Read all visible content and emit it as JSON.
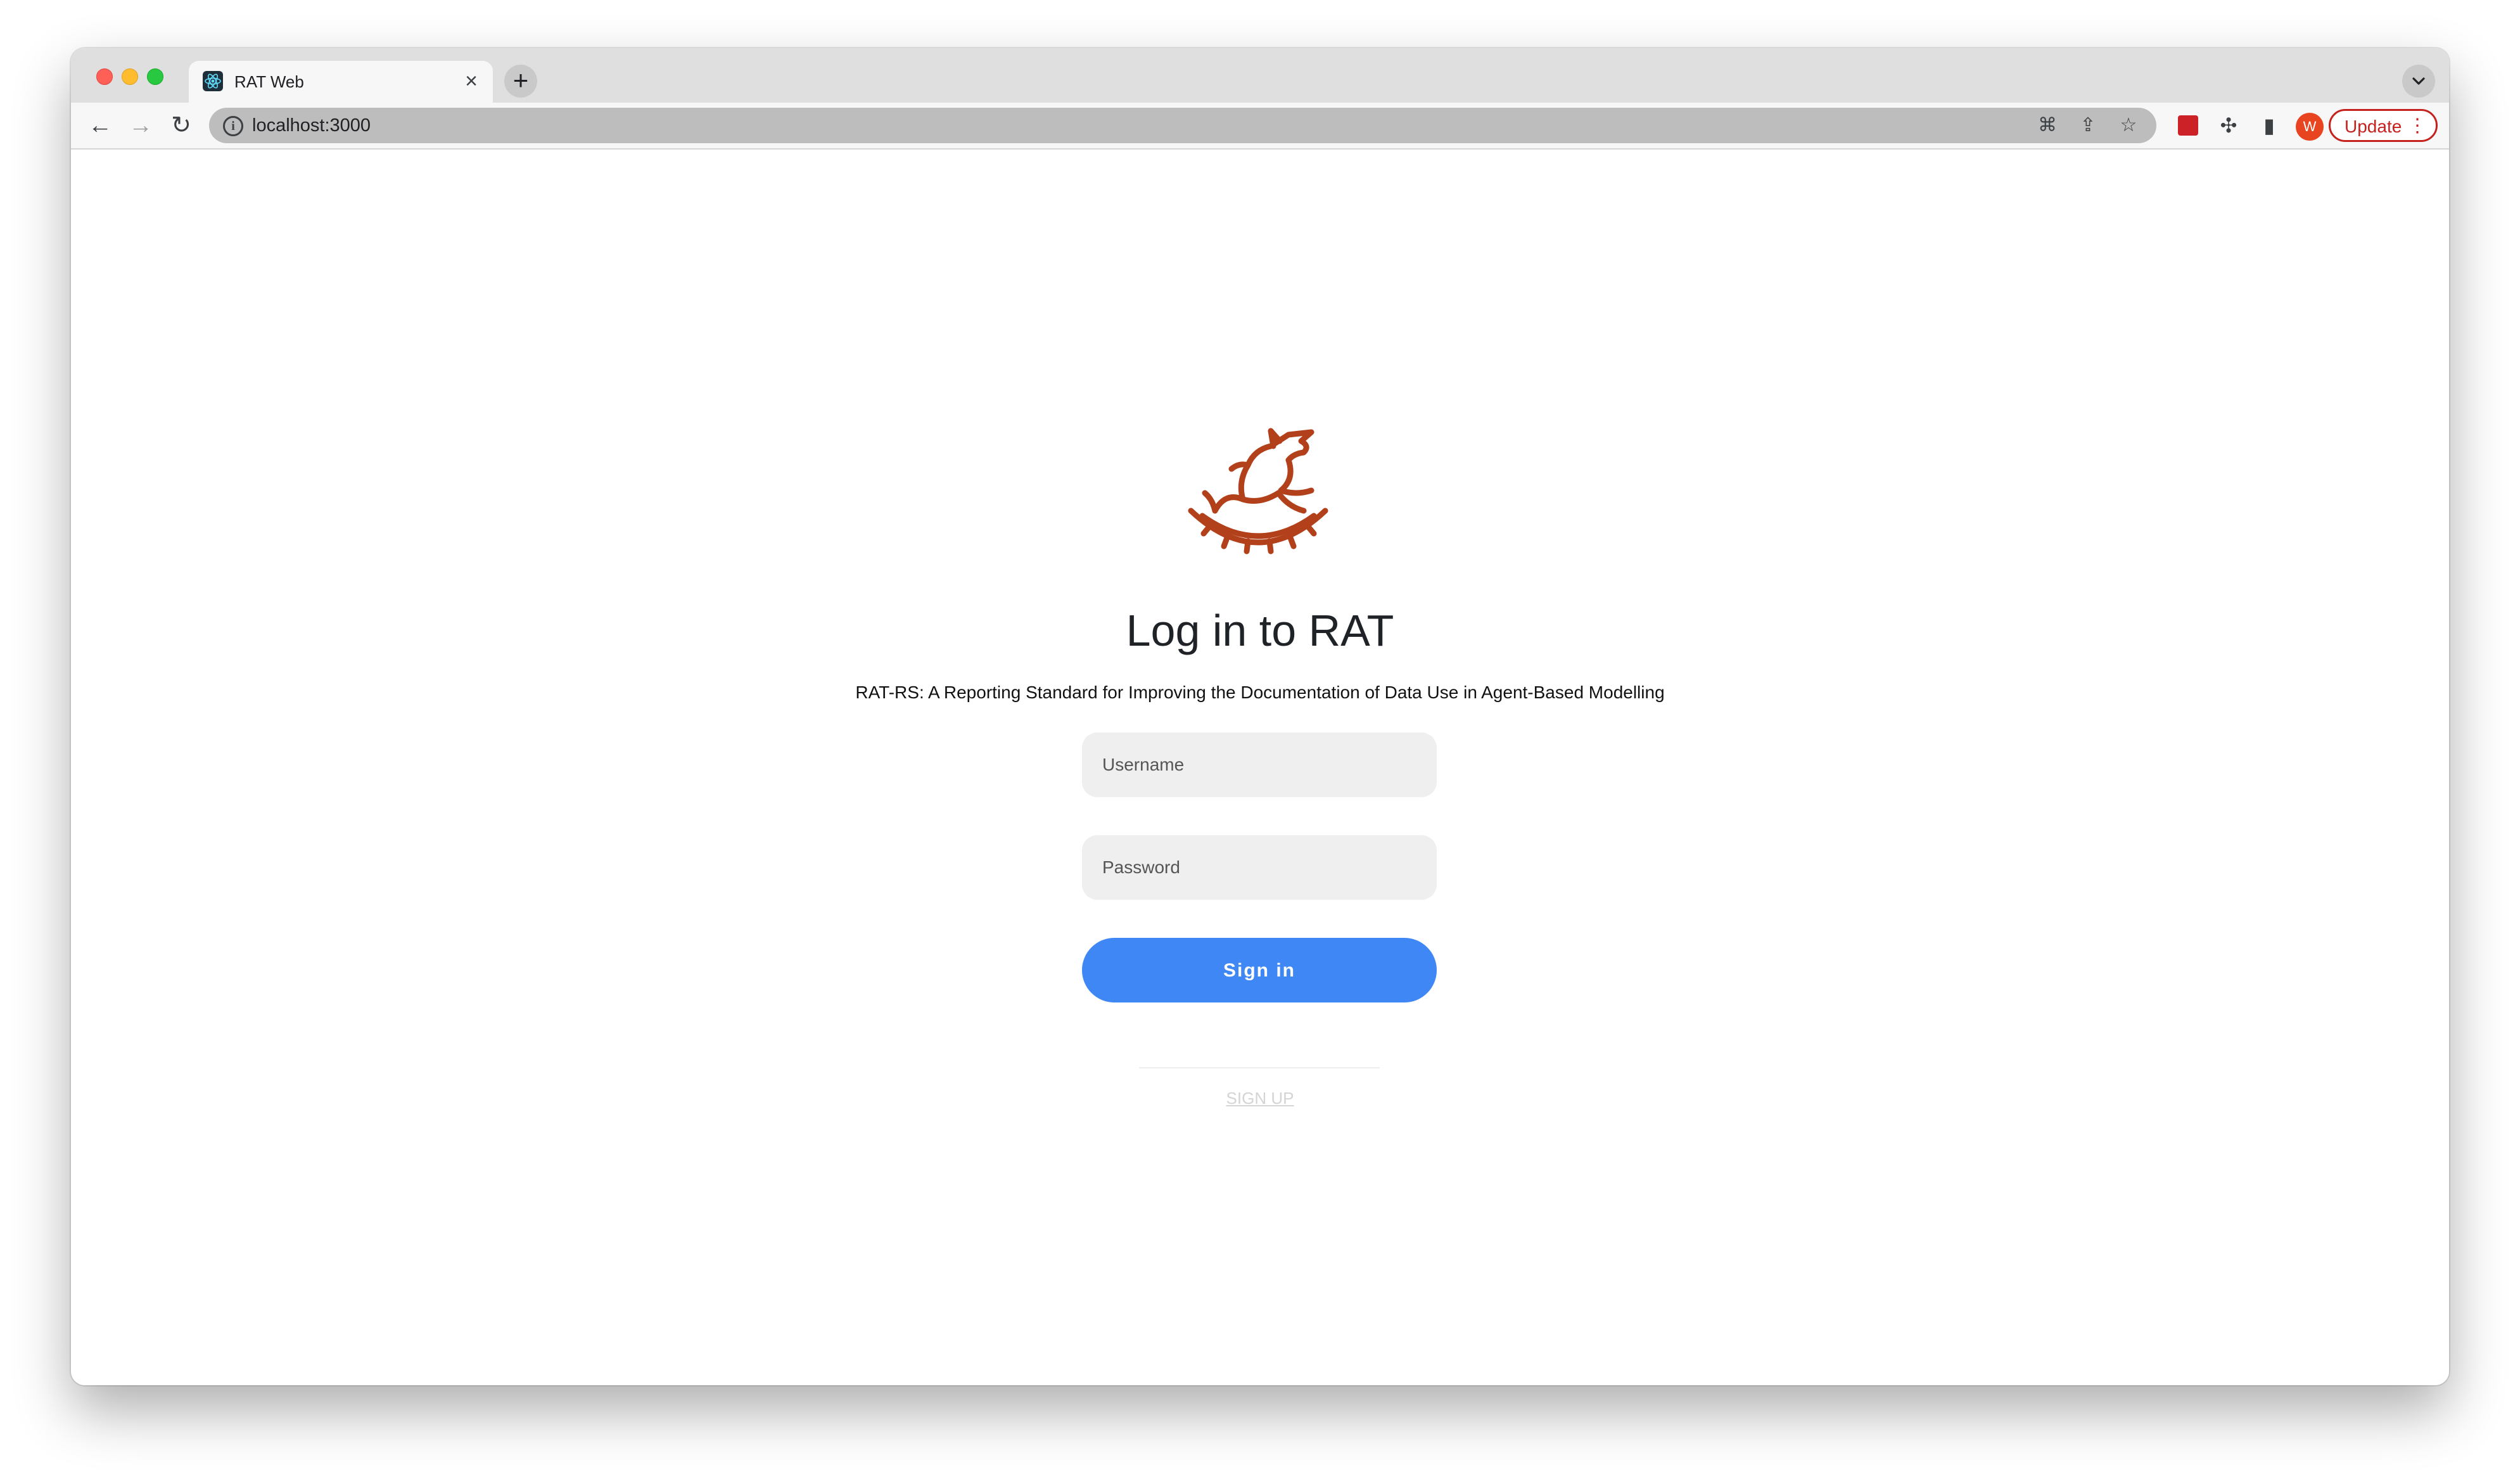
{
  "browser": {
    "tab": {
      "title": "RAT Web",
      "close_glyph": "×"
    },
    "new_tab_glyph": "+",
    "address_bar": {
      "url": "localhost:3000",
      "info_glyph": "i"
    },
    "nav": {
      "back_glyph": "←",
      "forward_glyph": "→",
      "reload_glyph": "↻"
    },
    "omnibox_icons": {
      "translate_glyph": "⌘",
      "share_glyph": "⇪",
      "star_glyph": "☆"
    },
    "toolbar_icons": {
      "puzzle_glyph": "✣",
      "sidepanel_glyph": "▮"
    },
    "profile": {
      "initial": "W",
      "color": "#e8441f"
    },
    "update": {
      "label": "Update",
      "dots": "⋮",
      "color": "#c5221f"
    }
  },
  "login": {
    "title": "Log in to RAT",
    "subtitle": "RAT-RS: A Reporting Standard for Improving the Documentation of Data Use in Agent-Based Modelling",
    "username_placeholder": "Username",
    "password_placeholder": "Password",
    "signin_label": "Sign in",
    "signup_label": "SIGN UP",
    "accent_color": "#3f87f5",
    "logo_color": "#b2411b"
  }
}
